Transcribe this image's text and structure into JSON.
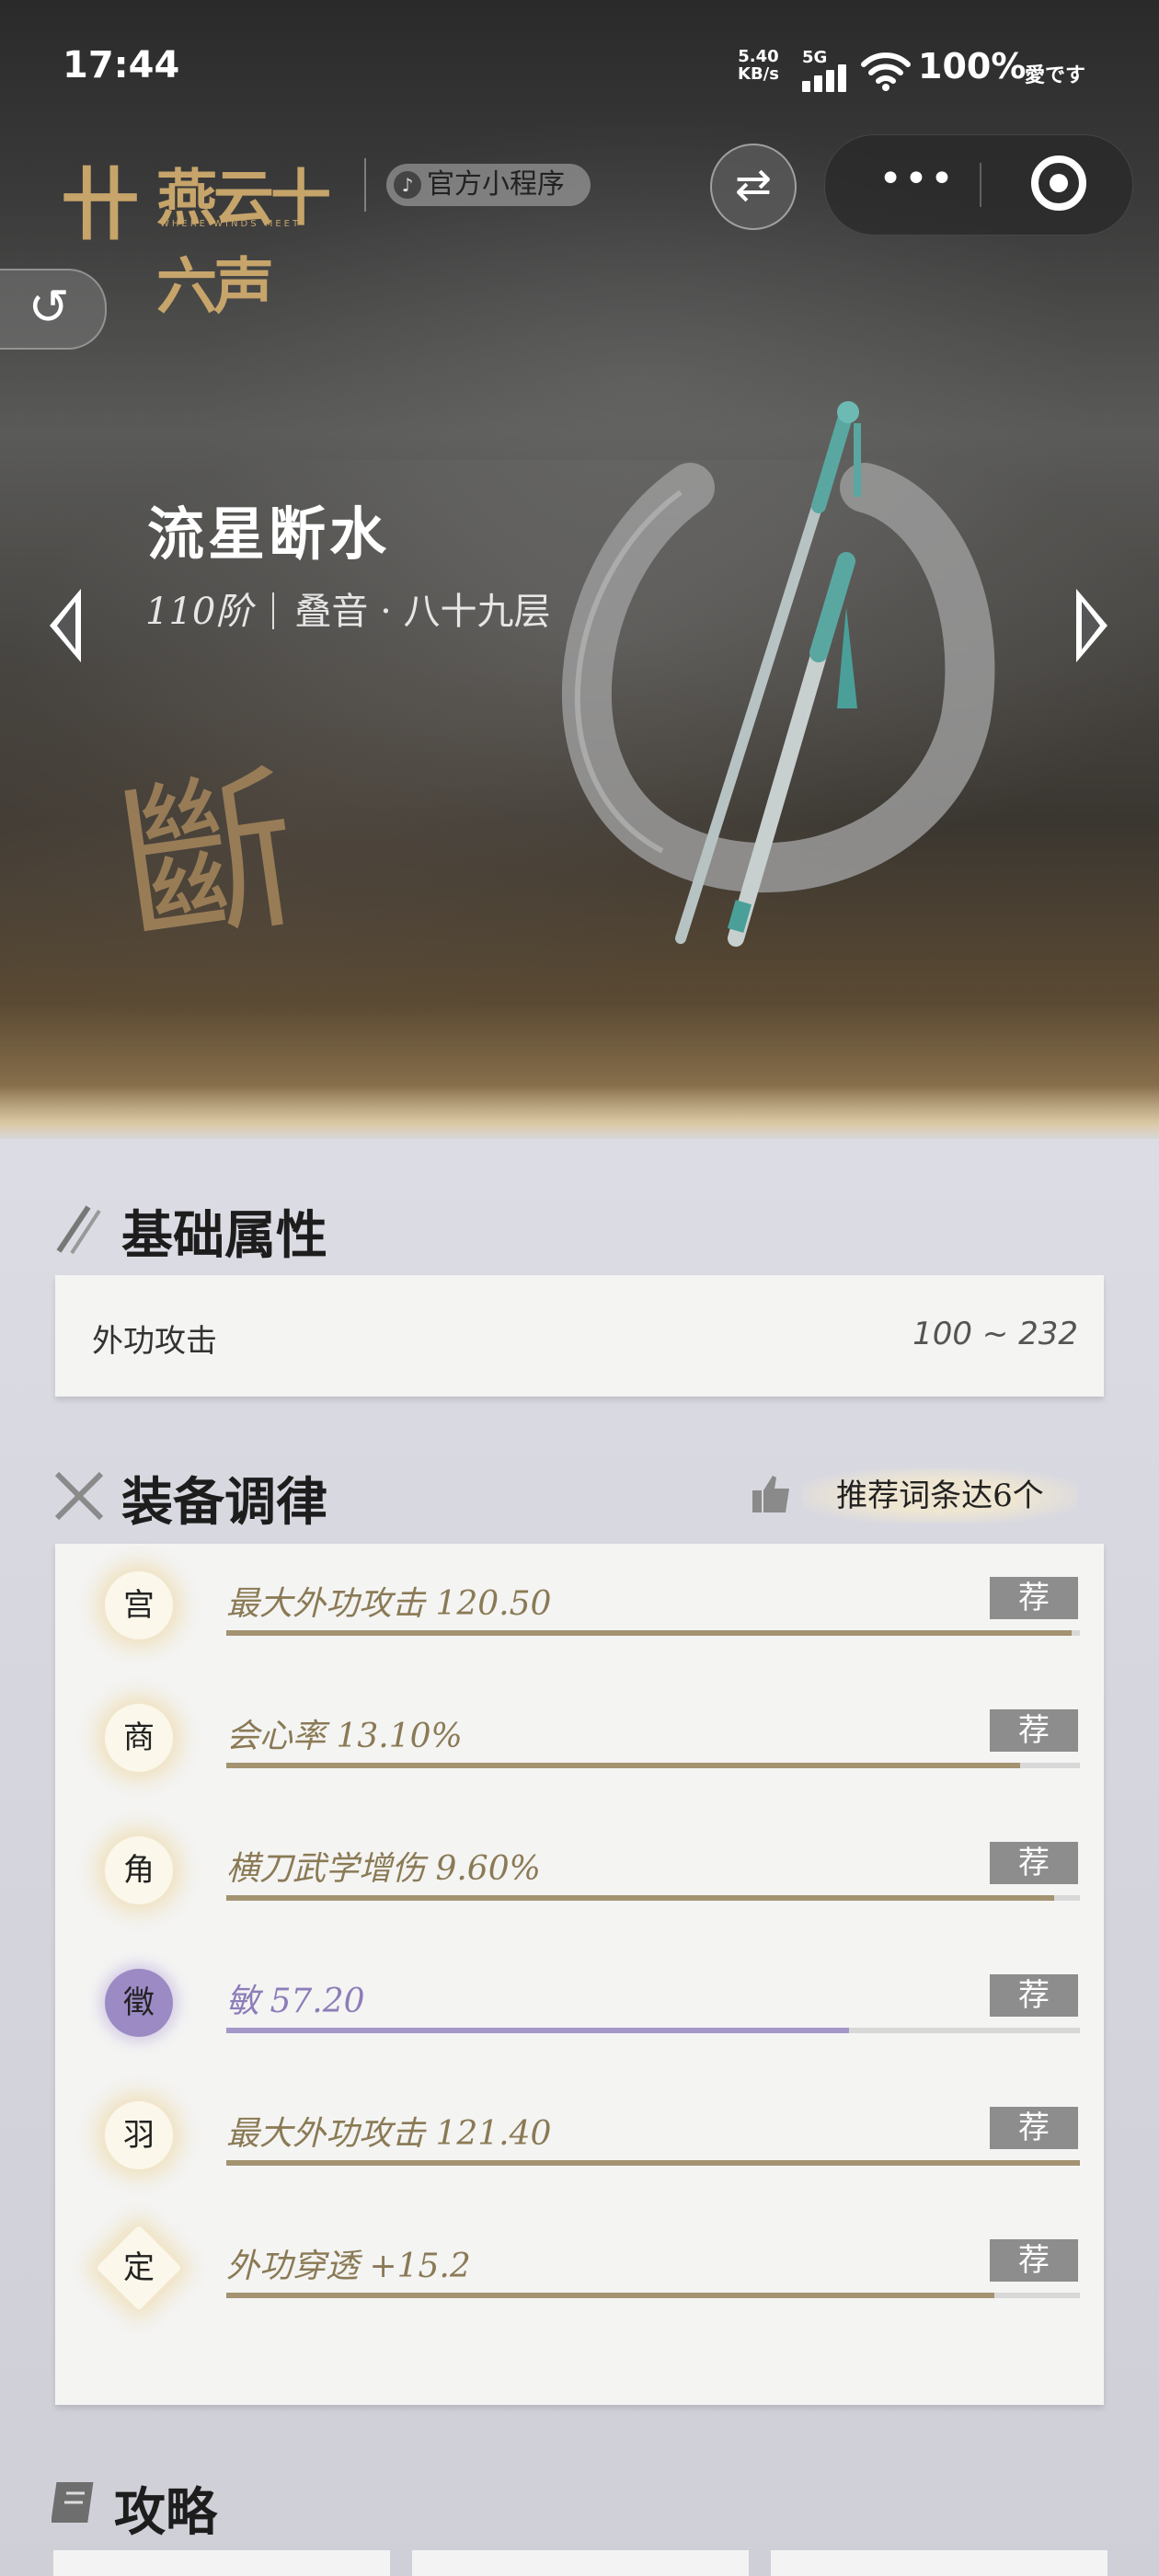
{
  "status_bar": {
    "time": "17:44",
    "net_speed_value": "5.40",
    "net_speed_unit": "KB/s",
    "network": "5G",
    "battery": "100%",
    "extra": "愛です"
  },
  "header": {
    "logo_mark": "卄",
    "logo_text": "燕云十六声",
    "logo_sub": "WHERE WINDS MEET",
    "mini_program_label": "官方小程序",
    "mini_program_icon": "tiktok-icon"
  },
  "weapon": {
    "name": "流星断水",
    "tier": "110阶",
    "layer": "叠音 · 八十九层",
    "brush_char": "斷"
  },
  "basic": {
    "title": "基础属性",
    "label": "外功攻击",
    "value": "100 ~ 232"
  },
  "tuning": {
    "title": "装备调律",
    "recommend_badge": "推荐词条达6个",
    "rows": [
      {
        "tone": "宫",
        "text": "最大外功攻击 120.50",
        "tag": "荐",
        "fill": 0.99,
        "style": "gold"
      },
      {
        "tone": "商",
        "text": "会心率 13.10%",
        "tag": "荐",
        "fill": 0.93,
        "style": "gold"
      },
      {
        "tone": "角",
        "text": "横刀武学增伤 9.60%",
        "tag": "荐",
        "fill": 0.97,
        "style": "gold"
      },
      {
        "tone": "徵",
        "text": "敏 57.20",
        "tag": "荐",
        "fill": 0.73,
        "style": "purple"
      },
      {
        "tone": "羽",
        "text": "最大外功攻击 121.40",
        "tag": "荐",
        "fill": 1.0,
        "style": "gold"
      },
      {
        "tone": "定",
        "text": "外功穿透 +15.2",
        "tag": "荐",
        "fill": 0.9,
        "style": "gold"
      }
    ]
  },
  "strategy": {
    "title": "攻略"
  },
  "colors": {
    "gold_text": "#8a7a55",
    "purple_text": "#8d7db8",
    "tag_bg": "#8d8d8d",
    "logo_gold": "#c6a46a"
  }
}
